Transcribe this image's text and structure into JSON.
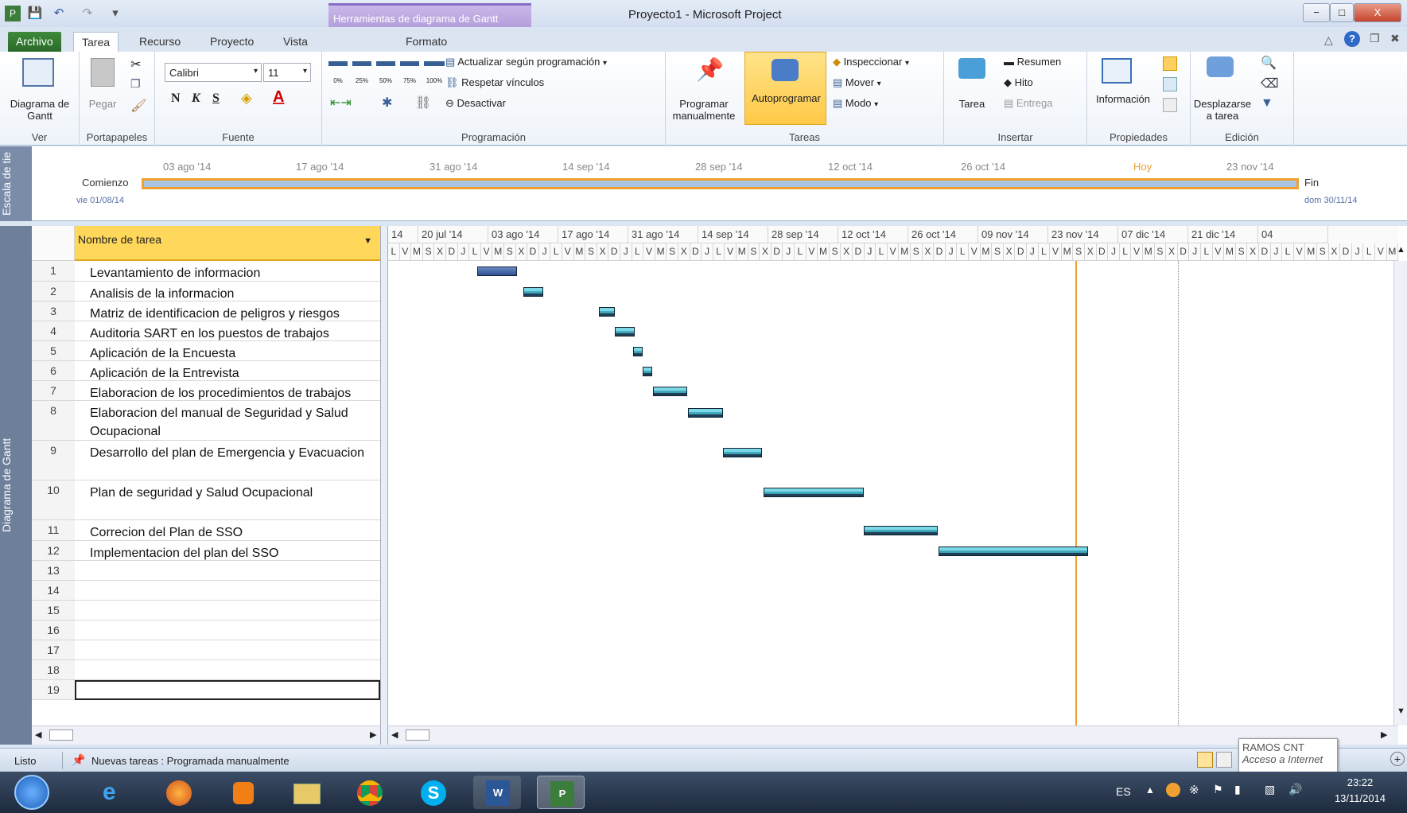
{
  "window": {
    "title": "Proyecto1  -  Microsoft Project",
    "context_tab": "Herramientas de diagrama de Gantt",
    "controls": [
      "−",
      "□",
      "X"
    ]
  },
  "tabs": [
    "Archivo",
    "Tarea",
    "Recurso",
    "Proyecto",
    "Vista",
    "Formato"
  ],
  "ribbon": {
    "ver": {
      "label": "Diagrama de Gantt",
      "group": "Ver"
    },
    "portapapeles": {
      "pegar": "Pegar",
      "group": "Portapapeles"
    },
    "fuente": {
      "font": "Calibri",
      "size": "11",
      "bold": "N",
      "italic": "K",
      "underline": "S",
      "group": "Fuente"
    },
    "programacion": {
      "percents": [
        "0%",
        "25%",
        "50%",
        "75%",
        "100%"
      ],
      "actualizar": "Actualizar según programación",
      "respetar": "Respetar vínculos",
      "desactivar": "Desactivar",
      "group": "Programación"
    },
    "tareas": {
      "programar": "Programar manualmente",
      "autoprogramar": "Autoprogramar",
      "inspeccionar": "Inspeccionar",
      "mover": "Mover",
      "modo": "Modo",
      "group": "Tareas"
    },
    "insertar": {
      "tarea": "Tarea",
      "resumen": "Resumen",
      "hito": "Hito",
      "entrega": "Entrega",
      "group": "Insertar"
    },
    "propiedades": {
      "informacion": "Información",
      "group": "Propiedades"
    },
    "edicion": {
      "desplazarse": "Desplazarse a tarea",
      "group": "Edición"
    }
  },
  "timeline": {
    "side_label": "Escala de tie",
    "start_label": "Comienzo",
    "start_date": "vie 01/08/14",
    "end_label": "Fin",
    "end_date": "dom 30/11/14",
    "hoy": "Hoy",
    "dates": [
      "03 ago '14",
      "17 ago '14",
      "31 ago '14",
      "14 sep '14",
      "28 sep '14",
      "12 oct '14",
      "26 oct '14",
      "23 nov '14"
    ]
  },
  "gantt": {
    "side_label": "Diagrama de Gantt",
    "column_header": "Nombre de tarea",
    "weeks": [
      "14",
      "20 jul '14",
      "03 ago '14",
      "17 ago '14",
      "31 ago '14",
      "14 sep '14",
      "28 sep '14",
      "12 oct '14",
      "26 oct '14",
      "09 nov '14",
      "23 nov '14",
      "07 dic '14",
      "21 dic '14",
      "04"
    ],
    "day_letters": [
      "L",
      "V",
      "M",
      "S",
      "X",
      "D",
      "J"
    ],
    "tasks": [
      {
        "id": "1",
        "name": "Levantamiento de informacion"
      },
      {
        "id": "2",
        "name": "Analisis de la informacion"
      },
      {
        "id": "3",
        "name": "Matriz de identificacion de peligros y riesgos"
      },
      {
        "id": "4",
        "name": "Auditoria SART en los puestos de trabajos"
      },
      {
        "id": "5",
        "name": "Aplicación de la Encuesta"
      },
      {
        "id": "6",
        "name": "Aplicación de la Entrevista"
      },
      {
        "id": "7",
        "name": "Elaboracion de los procedimientos de trabajos"
      },
      {
        "id": "8",
        "name": "Elaboracion del manual de Seguridad y Salud Ocupacional"
      },
      {
        "id": "9",
        "name": "Desarrollo del plan de Emergencia y Evacuacion"
      },
      {
        "id": "10",
        "name": "Plan de seguridad y Salud Ocupacional"
      },
      {
        "id": "11",
        "name": "Correcion del Plan de SSO"
      },
      {
        "id": "12",
        "name": "Implementacion del plan del SSO"
      },
      {
        "id": "13",
        "name": ""
      },
      {
        "id": "14",
        "name": ""
      },
      {
        "id": "15",
        "name": ""
      },
      {
        "id": "16",
        "name": ""
      },
      {
        "id": "17",
        "name": ""
      },
      {
        "id": "18",
        "name": ""
      },
      {
        "id": "19",
        "name": ""
      }
    ]
  },
  "status": {
    "listo": "Listo",
    "nuevas": "Nuevas tareas : Programada manualmente"
  },
  "tooltip": {
    "line1": "RAMOS CNT",
    "line2": "Acceso a Internet"
  },
  "taskbar": {
    "lang": "ES",
    "time": "23:22",
    "date": "13/11/2014"
  },
  "colors": {
    "accent_orange": "#f0a030",
    "bar_teal": "#2a8ea2",
    "today_line": "#f0a030",
    "file_tab": "#2a6a2a"
  }
}
